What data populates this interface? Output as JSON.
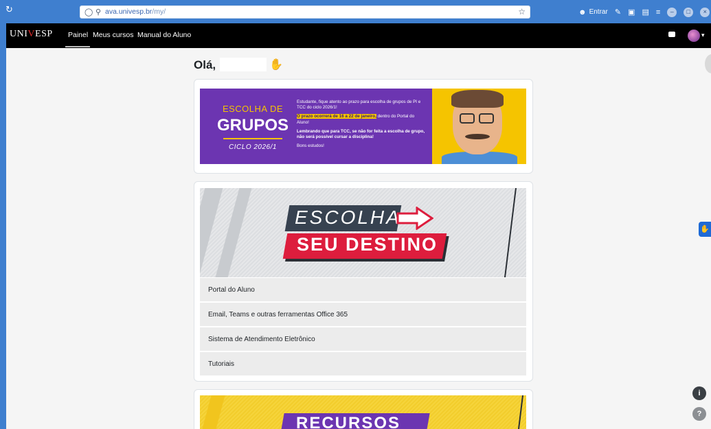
{
  "browser": {
    "url_host": "ava.univesp.br",
    "url_path": "/my/",
    "signin_label": "Entrar",
    "icons": [
      "reload-icon",
      "shield-icon",
      "lock-icon",
      "star-icon",
      "account-icon",
      "extensions-icon",
      "screenshot-icon",
      "sidebar-icon",
      "menu-icon",
      "minimize-icon",
      "restore-icon",
      "close-icon"
    ]
  },
  "site": {
    "logo_left": "UNI",
    "logo_mark": "V",
    "logo_right": "ESP",
    "nav": [
      "Painel",
      "Meus cursos",
      "Manual do Aluno"
    ]
  },
  "main": {
    "greeting": "Olá,",
    "banner1": {
      "title_line1": "ESCOLHA DE",
      "title_line2": "GRUPOS",
      "title_line3": "CICLO 2026/1",
      "para1": "Estudante, fique atento ao prazo para escolha de grupos de PI e TCC do ciclo 2026/1!",
      "para2_highlight": "O prazo ocorrerá de 16 a 22 de janeiro,",
      "para2_rest": "dentro do Portal do Aluno!",
      "para3": "Lembrando que para TCC, se não for feita a escolha de grupo, não será possível cursar a disciplina!",
      "para4": "Bons estudos!"
    },
    "banner2": {
      "line1": "ESCOLHA",
      "line2": "SEU DESTINO"
    },
    "links": [
      "Portal do Aluno",
      "Email, Teams e outras ferramentas Office 365",
      "Sistema de Atendimento Eletrônico",
      "Tutoriais"
    ],
    "banner3": {
      "text": "RECURSOS"
    }
  },
  "floating": {
    "help_symbol": "?",
    "info_symbol": "i"
  },
  "colors": {
    "browser_accent": "#3f7fcf",
    "nav_bg": "#000000",
    "banner_purple": "#6c35b1",
    "banner_yellow": "#f5c400",
    "banner_red": "#dd1d3d"
  }
}
